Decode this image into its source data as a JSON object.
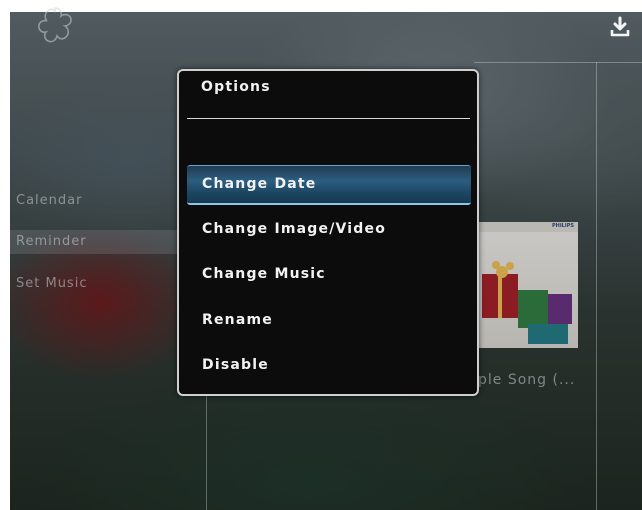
{
  "screen": {
    "top_icons": {
      "left": "flower-icon",
      "right": "download-icon"
    },
    "sidebar": {
      "items": [
        {
          "label": "Calendar"
        },
        {
          "label": "Reminder"
        },
        {
          "label": "Set Music"
        }
      ]
    },
    "album": {
      "label": "ple Song (...",
      "cover_brand": "PHILIPS"
    }
  },
  "dialog": {
    "title": "Options",
    "items": [
      {
        "label": "Change Date",
        "selected": true
      },
      {
        "label": "Change Image/Video",
        "selected": false
      },
      {
        "label": "Change Music",
        "selected": false
      },
      {
        "label": "Rename",
        "selected": false
      },
      {
        "label": "Disable",
        "selected": false
      }
    ]
  },
  "colors": {
    "dialog_bg": "#0c0c0c",
    "dialog_border": "#cfcfcf",
    "selected_highlight": "#2c5e80",
    "selected_glow": "#8ec6e6"
  }
}
